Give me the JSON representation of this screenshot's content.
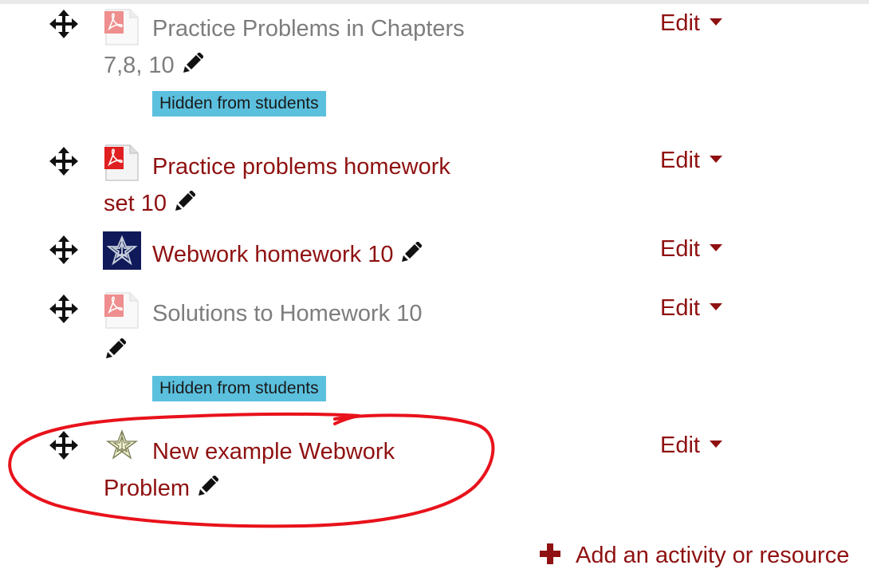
{
  "activities": [
    {
      "name_line1": "Practice Problems in Chapters",
      "name_line2": "7,8, 10",
      "icon": "pdf-icon",
      "hidden": true,
      "badge": "Hidden from students",
      "edit_label": "Edit"
    },
    {
      "name_line1": "Practice problems homework",
      "name_line2": "set 10",
      "icon": "pdf-icon",
      "hidden": false,
      "edit_label": "Edit"
    },
    {
      "name_line1": "Webwork homework 10",
      "icon": "webwork-icon",
      "hidden": false,
      "edit_label": "Edit"
    },
    {
      "name_line1": "Solutions to Homework 10",
      "icon": "pdf-icon",
      "hidden": true,
      "badge": "Hidden from students",
      "edit_label": "Edit"
    },
    {
      "name_line1": "New example Webwork",
      "name_line2": "Problem",
      "icon": "webwork-star-icon",
      "hidden": false,
      "edit_label": "Edit"
    }
  ],
  "footer": {
    "add_label": "Add an activity or resource"
  },
  "colors": {
    "link": "#8f1111",
    "dimmed": "#7d7d7d",
    "badge_bg": "#5bc0de",
    "annotation": "#e8121b"
  }
}
